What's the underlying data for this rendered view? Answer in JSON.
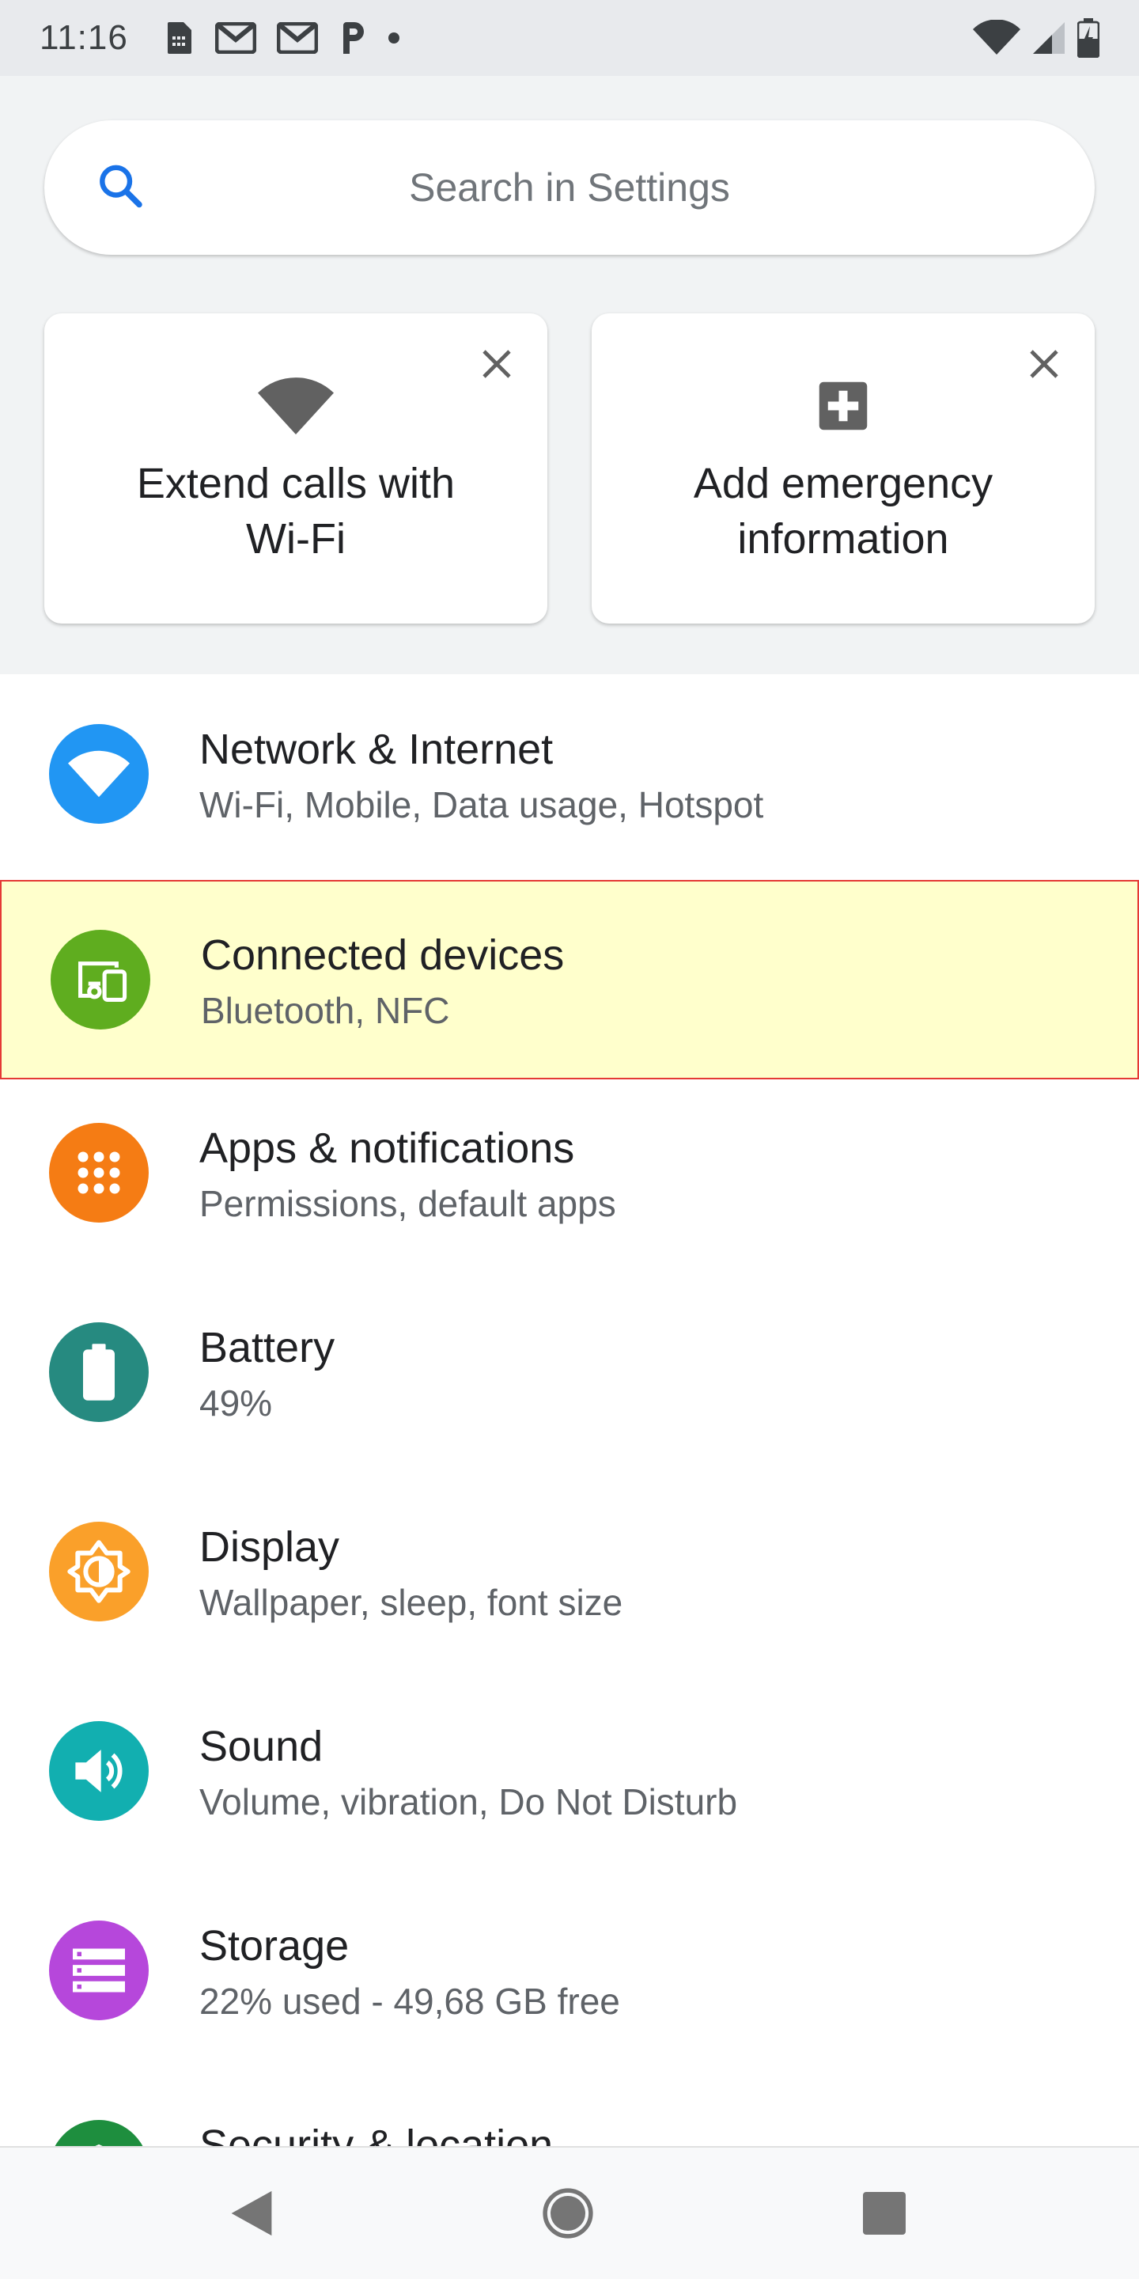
{
  "status_bar": {
    "time": "11:16",
    "left_icons": [
      "sim-card-icon",
      "gmail-icon",
      "gmail-icon",
      "parking-icon",
      "dot-icon"
    ],
    "right_icons": [
      "wifi-signal-icon",
      "cell-signal-icon",
      "battery-charging-icon"
    ]
  },
  "search": {
    "placeholder": "Search in Settings",
    "icon": "search-icon",
    "icon_color": "#1a73e8"
  },
  "suggestions": [
    {
      "line1": "Extend calls with",
      "line2": "Wi-Fi",
      "icon": "wifi-icon"
    },
    {
      "line1": "Add emergency",
      "line2": "information",
      "icon": "medical-cross-icon"
    }
  ],
  "settings": {
    "items": [
      {
        "title": "Network & Internet",
        "subtitle": "Wi-Fi, Mobile, Data usage, Hotspot",
        "icon": "wifi-icon",
        "color": "#2196f3"
      },
      {
        "title": "Connected devices",
        "subtitle": "Bluetooth, NFC",
        "icon": "devices-icon",
        "color": "#5fad1f",
        "highlighted": true
      },
      {
        "title": "Apps & notifications",
        "subtitle": "Permissions, default apps",
        "icon": "apps-grid-icon",
        "color": "#f57c14"
      },
      {
        "title": "Battery",
        "subtitle": "49%",
        "icon": "battery-icon",
        "color": "#268a80"
      },
      {
        "title": "Display",
        "subtitle": "Wallpaper, sleep, font size",
        "icon": "brightness-icon",
        "color": "#faa02a"
      },
      {
        "title": "Sound",
        "subtitle": "Volume, vibration, Do Not Disturb",
        "icon": "volume-icon",
        "color": "#12afb0"
      },
      {
        "title": "Storage",
        "subtitle": "22% used - 49,68 GB free",
        "icon": "storage-icon",
        "color": "#b647db"
      },
      {
        "title": "Security & location",
        "subtitle": "",
        "icon": "security-icon",
        "color": "#1e8e3e"
      }
    ]
  },
  "nav": {
    "icons": [
      "back-icon",
      "home-icon",
      "recents-icon"
    ]
  }
}
